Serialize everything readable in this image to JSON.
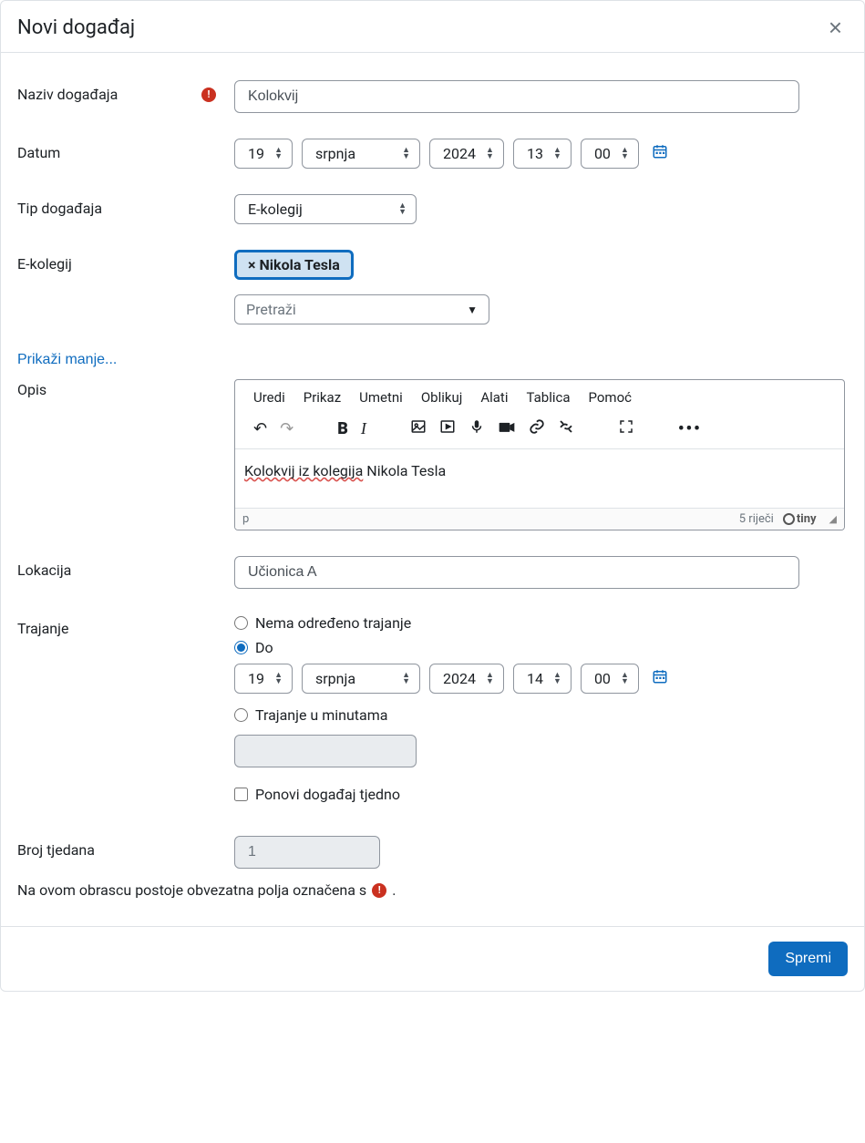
{
  "header": {
    "title": "Novi događaj"
  },
  "fields": {
    "name": {
      "label": "Naziv događaja",
      "value": "Kolokvij"
    },
    "date": {
      "label": "Datum",
      "day": "19",
      "month": "srpnja",
      "year": "2024",
      "hour": "13",
      "minute": "00"
    },
    "type": {
      "label": "Tip događaja",
      "value": "E-kolegij"
    },
    "course": {
      "label": "E-kolegij",
      "chip": "Nikola Tesla",
      "search_placeholder": "Pretraži"
    },
    "toggle_link": "Prikaži manje...",
    "description": {
      "label": "Opis",
      "menu": {
        "edit": "Uredi",
        "view": "Prikaz",
        "insert": "Umetni",
        "format": "Oblikuj",
        "tools": "Alati",
        "table": "Tablica",
        "help": "Pomoć"
      },
      "content_sq": "Kolokvij iz kolegija",
      "content_rest": " Nikola Tesla",
      "status_path": "p",
      "word_count": "5 riječi",
      "brand": "tiny"
    },
    "location": {
      "label": "Lokacija",
      "value": "Učionica A"
    },
    "duration": {
      "label": "Trajanje",
      "opt_none": "Nema određeno trajanje",
      "opt_until": "Do",
      "until": {
        "day": "19",
        "month": "srpnja",
        "year": "2024",
        "hour": "14",
        "minute": "00"
      },
      "opt_minutes": "Trajanje u minutama",
      "minutes_value": "",
      "repeat_label": "Ponovi događaj tjedno"
    },
    "weeks": {
      "label": "Broj tjedana",
      "value": "1"
    }
  },
  "required_note": {
    "prefix": "Na ovom obrascu postoje obvezatna polja označena s",
    "suffix": "."
  },
  "footer": {
    "save": "Spremi"
  }
}
